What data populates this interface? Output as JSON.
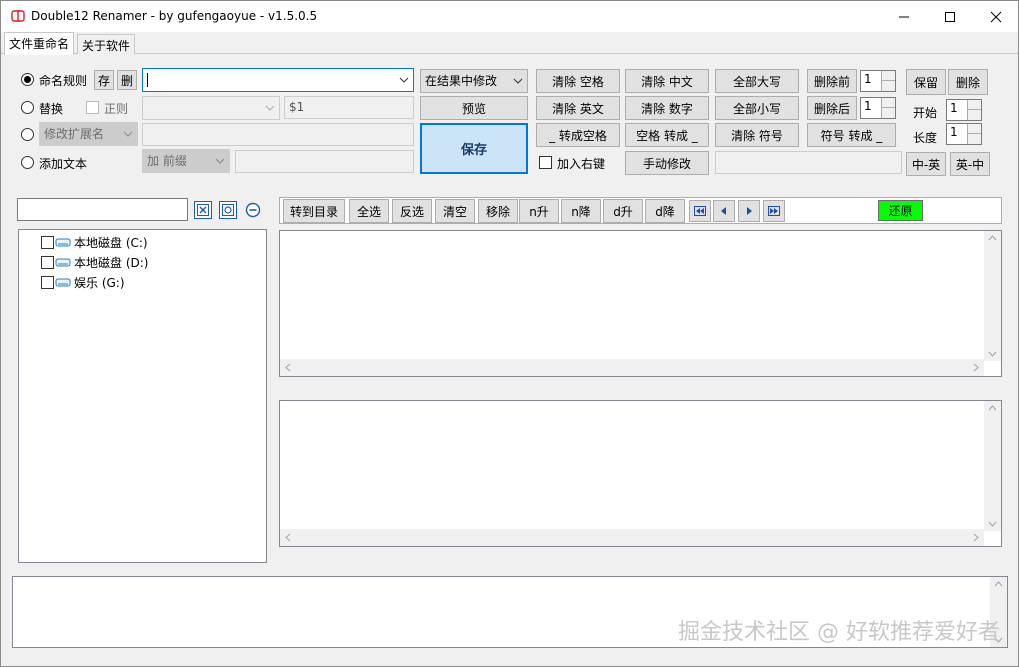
{
  "window": {
    "title": "Double12 Renamer - by gufengaoyue - v1.5.0.5",
    "controls": [
      "minimize-icon",
      "maximize-icon",
      "close-icon"
    ]
  },
  "tabs": [
    {
      "label": "文件重命名",
      "active": true
    },
    {
      "label": "关于软件",
      "active": false
    }
  ],
  "rules": {
    "rename_rule_label": "命名规则",
    "save_rule_label": "存",
    "delete_rule_label": "删",
    "rule_value": "",
    "replace_label": "替换",
    "regex_label": "正则",
    "replace_with_value": "$1",
    "ext_label": "修改扩展名",
    "add_text_label": "添加文本",
    "add_position": "加 前缀"
  },
  "actions": {
    "modify_in_result": "在结果中修改",
    "preview": "预览",
    "save": "保存",
    "add_context_menu": "加入右键"
  },
  "buttons": {
    "clear_space": "清除 空格",
    "clear_english": "清除 英文",
    "underscore_to_space": "_ 转成空格",
    "clear_chinese": "清除 中文",
    "clear_digits": "清除 数字",
    "space_to_underscore": "空格 转成 _",
    "manual_edit": "手动修改",
    "all_upper": "全部大写",
    "all_lower": "全部小写",
    "clear_symbols": "清除 符号",
    "delete_before": "删除前",
    "delete_after": "删除后",
    "symbol_to_underscore": "符号 转成 _",
    "keep": "保留",
    "delete": "删除",
    "start_label": "开始",
    "length_label": "长度",
    "zh_en": "中-英",
    "en_zh": "英-中"
  },
  "spinners": {
    "delete_before_value": "1",
    "delete_after_value": "1",
    "start_value": "1",
    "length_value": "1"
  },
  "toolbar": {
    "goto_dir": "转到目录",
    "select_all": "全选",
    "invert": "反选",
    "clear": "清空",
    "remove": "移除",
    "n_asc": "n升",
    "n_desc": "n降",
    "d_asc": "d升",
    "d_desc": "d降",
    "restore": "还原",
    "restore_color": "#00ff00"
  },
  "tree": {
    "items": [
      {
        "label": "本地磁盘 (C:)"
      },
      {
        "label": "本地磁盘 (D:)"
      },
      {
        "label": "娱乐 (G:)"
      }
    ]
  },
  "watermark": "掘金技术社区 @ 好软推荐爱好者"
}
